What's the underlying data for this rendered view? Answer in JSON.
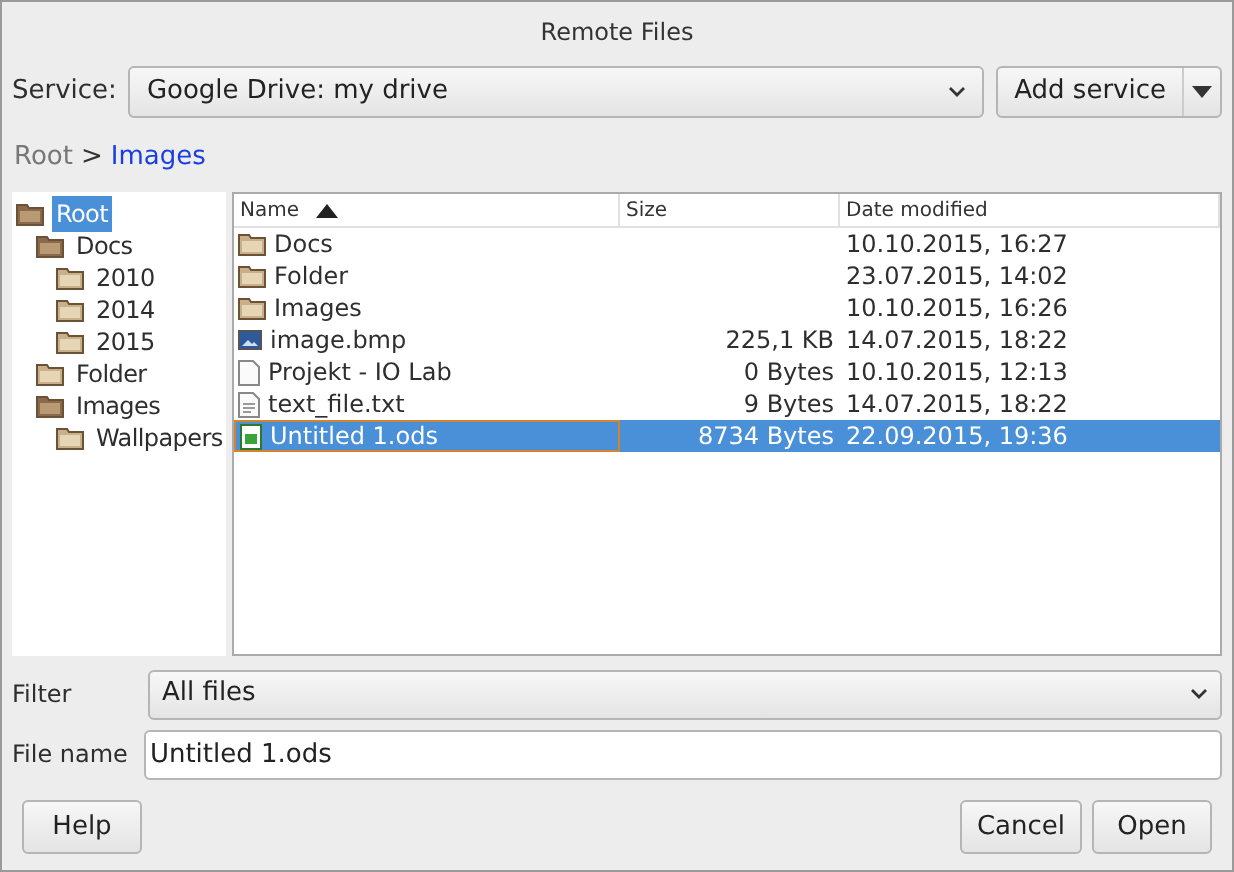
{
  "window": {
    "title": "Remote Files"
  },
  "service": {
    "label": "Service:",
    "value": "Google Drive: my drive",
    "add_button": "Add service"
  },
  "breadcrumb": [
    {
      "label": "Root",
      "selected": false
    },
    {
      "label": ">",
      "kind": "separator"
    },
    {
      "label": "Images",
      "selected": true
    }
  ],
  "tree": [
    {
      "label": "Root",
      "expanded": true,
      "selected": true,
      "children": [
        {
          "label": "Docs",
          "expanded": true,
          "selected": false,
          "children": [
            {
              "label": "2010",
              "expanded": false,
              "selected": false
            },
            {
              "label": "2014",
              "expanded": false,
              "selected": false
            },
            {
              "label": "2015",
              "expanded": false,
              "selected": false
            }
          ]
        },
        {
          "label": "Folder",
          "expanded": false,
          "selected": false
        },
        {
          "label": "Images",
          "expanded": true,
          "selected": false,
          "children": [
            {
              "label": "Wallpapers",
              "expanded": false,
              "selected": false
            }
          ]
        }
      ]
    }
  ],
  "table": {
    "columns": [
      "Name",
      "Size",
      "Date modified"
    ],
    "rows": [
      {
        "kind": "folder",
        "name": "Docs",
        "size": "",
        "date": "10.10.2015, 16:27",
        "selected": false
      },
      {
        "kind": "folder",
        "name": "Folder",
        "size": "",
        "date": "23.07.2015, 14:02",
        "selected": false
      },
      {
        "kind": "folder",
        "name": "Images",
        "size": "",
        "date": "10.10.2015, 16:26",
        "selected": false
      },
      {
        "kind": "image",
        "name": "image.bmp",
        "size": "225,1 KB",
        "date": "14.07.2015, 18:22",
        "selected": false
      },
      {
        "kind": "document",
        "name": "Projekt - IO Lab",
        "size": "0 Bytes",
        "date": "10.10.2015, 12:13",
        "selected": false
      },
      {
        "kind": "text",
        "name": "text_file.txt",
        "size": "9 Bytes",
        "date": "14.07.2015, 18:22",
        "selected": false
      },
      {
        "kind": "spreadsheet",
        "name": "Untitled 1.ods",
        "size": "8734 Bytes",
        "date": "22.09.2015, 19:36",
        "selected": true
      }
    ]
  },
  "filter": {
    "label": "Filter",
    "value": "All files"
  },
  "file_name": {
    "label": "File name",
    "value": "Untitled 1.ods"
  },
  "buttons": {
    "help": "Help",
    "cancel": "Cancel",
    "open": "Open"
  }
}
